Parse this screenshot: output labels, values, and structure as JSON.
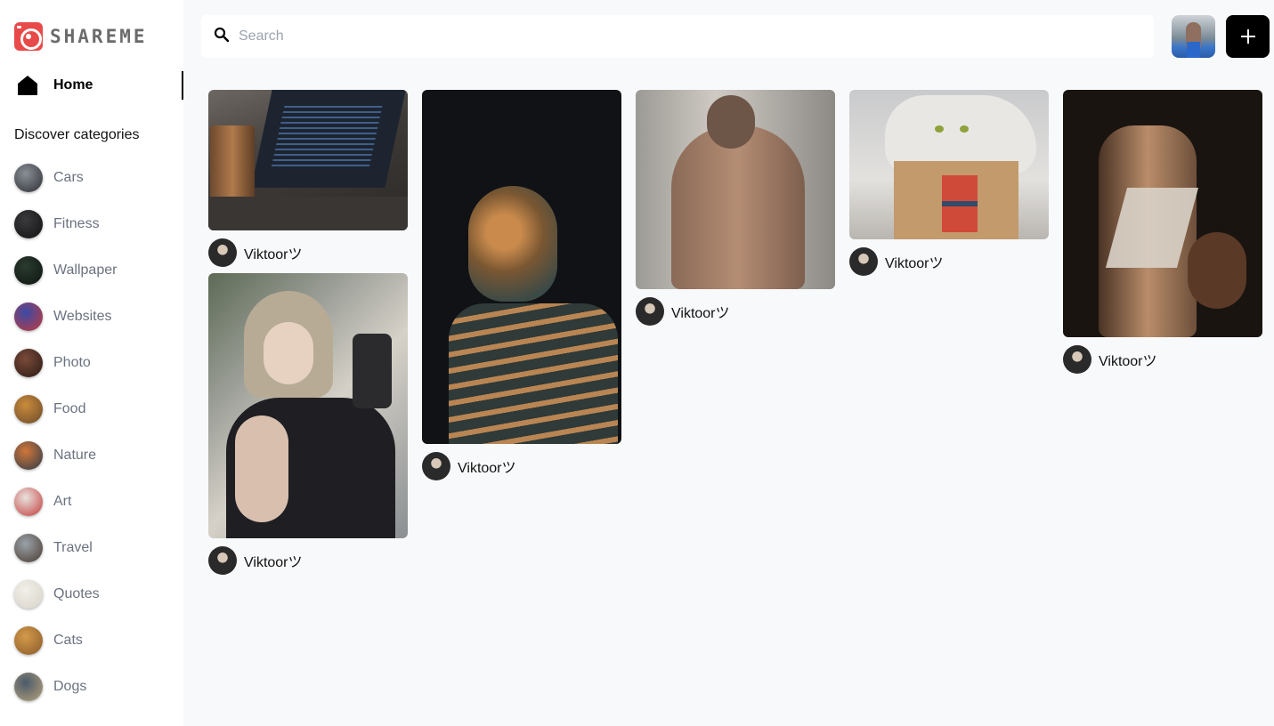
{
  "app": {
    "logo_text": "SHAREME"
  },
  "sidebar": {
    "home_label": "Home",
    "discover_title": "Discover categories",
    "categories": [
      {
        "label": "Cars",
        "color_a": "#8a8f96",
        "color_b": "#2c2f34"
      },
      {
        "label": "Fitness",
        "color_a": "#3a3a3c",
        "color_b": "#111113"
      },
      {
        "label": "Wallpaper",
        "color_a": "#2b3b2f",
        "color_b": "#0c1410"
      },
      {
        "label": "Websites",
        "color_a": "#3b4aa8",
        "color_b": "#c23a3a"
      },
      {
        "label": "Photo",
        "color_a": "#7a4a3a",
        "color_b": "#2a1a14"
      },
      {
        "label": "Food",
        "color_a": "#c98b3c",
        "color_b": "#6b4a2a"
      },
      {
        "label": "Nature",
        "color_a": "#d2763a",
        "color_b": "#2a3a4a"
      },
      {
        "label": "Art",
        "color_a": "#e9e3de",
        "color_b": "#c23a3a"
      },
      {
        "label": "Travel",
        "color_a": "#9aa2aa",
        "color_b": "#4a3a2e"
      },
      {
        "label": "Quotes",
        "color_a": "#f1efe9",
        "color_b": "#d8d3c8"
      },
      {
        "label": "Cats",
        "color_a": "#d39a4a",
        "color_b": "#8a5a2a"
      },
      {
        "label": "Dogs",
        "color_a": "#4a5a6a",
        "color_b": "#b8a27a"
      }
    ]
  },
  "search": {
    "placeholder": "Search"
  },
  "pins": [
    {
      "author": "Viktoorツ",
      "image": "laptop-code"
    },
    {
      "author": "Viktoorツ",
      "image": "girl-selfie"
    },
    {
      "author": "Viktoorツ",
      "image": "bronze-skeleton"
    },
    {
      "author": "Viktoorツ",
      "image": "man-back"
    },
    {
      "author": "Viktoorツ",
      "image": "cat-in-box"
    },
    {
      "author": "Viktoorツ",
      "image": "david-goliath-painting"
    }
  ],
  "colors": {
    "brand": "#e84a4a",
    "background": "#f8f9fb",
    "sidebar": "#ffffff",
    "accent": "#000000"
  }
}
